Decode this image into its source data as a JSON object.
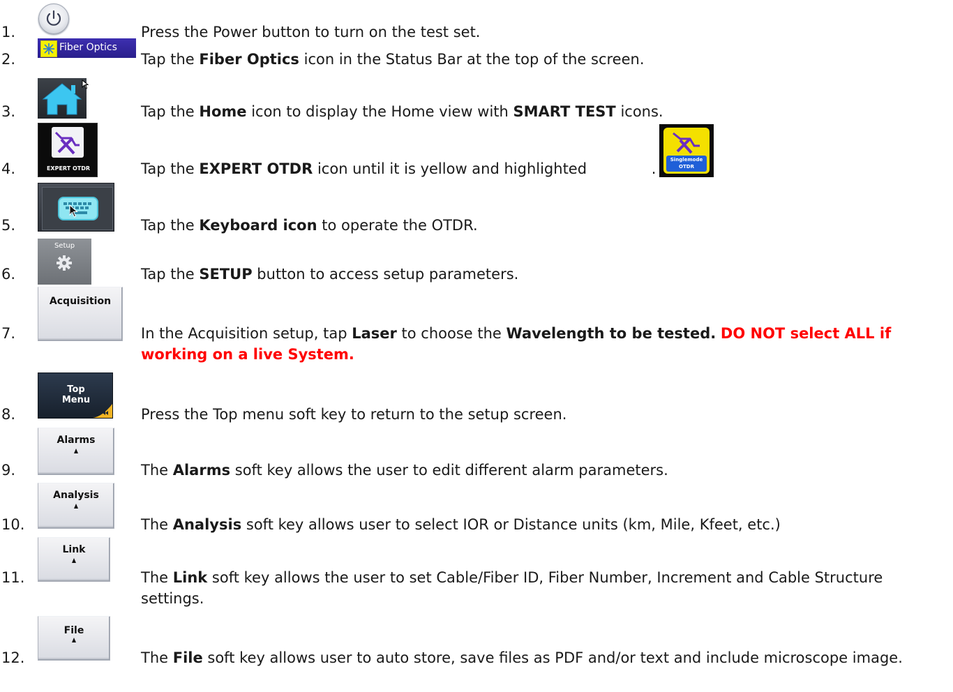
{
  "steps": [
    {
      "n": "1.",
      "icon": "power-button-icon",
      "segments": [
        {
          "t": "Press the Power button to turn on the test set."
        }
      ]
    },
    {
      "n": "2.",
      "icon": "fiber-optics-icon",
      "icon_label": "Fiber Optics",
      "segments": [
        {
          "t": "Tap the "
        },
        {
          "t": "Fiber Optics",
          "b": true
        },
        {
          "t": " icon in the Status Bar at the top of the screen."
        }
      ]
    },
    {
      "n": "3.",
      "icon": "home-icon",
      "segments": [
        {
          "t": "Tap the "
        },
        {
          "t": "Home",
          "b": true
        },
        {
          "t": " icon to display the Home view with "
        },
        {
          "t": "SMART TEST",
          "b": true
        },
        {
          "t": " icons."
        }
      ]
    },
    {
      "n": "4.",
      "icon": "expert-otdr-icon",
      "icon_label": "EXPERT OTDR",
      "segments": [
        {
          "t": "Tap the "
        },
        {
          "t": "EXPERT OTDR",
          "b": true
        },
        {
          "t": " icon until it is yellow and highlighted "
        }
      ],
      "trail": "."
    },
    {
      "n": "5.",
      "icon": "keyboard-icon",
      "segments": [
        {
          "t": "Tap the "
        },
        {
          "t": "Keyboard icon",
          "b": true
        },
        {
          "t": " to operate the OTDR."
        }
      ]
    },
    {
      "n": "6.",
      "icon": "setup-gear-icon",
      "icon_label": "Setup",
      "segments": [
        {
          "t": "Tap the "
        },
        {
          "t": "SETUP",
          "b": true
        },
        {
          "t": " button to access setup parameters."
        }
      ]
    },
    {
      "n": "7.",
      "icon": "acquisition-softkey",
      "icon_label": "Acquisition",
      "segments": [
        {
          "t": "In the Acquisition setup, tap "
        },
        {
          "t": "Laser",
          "b": true
        },
        {
          "t": " to choose the "
        },
        {
          "t": "Wavelength to be tested.",
          "b": true
        },
        {
          "t": "  "
        },
        {
          "t": "DO NOT select ALL if working on a live System.",
          "r": true
        }
      ]
    },
    {
      "n": "8.",
      "icon": "top-menu-softkey",
      "icon_label": "Top\nMenu",
      "segments": [
        {
          "t": "Press the Top menu soft key to return to the setup screen."
        }
      ]
    },
    {
      "n": "9.",
      "icon": "alarms-softkey",
      "icon_label": "Alarms",
      "segments": [
        {
          "t": "The "
        },
        {
          "t": "Alarms",
          "b": true
        },
        {
          "t": " soft key allows the user to edit different alarm parameters."
        }
      ]
    },
    {
      "n": "10.",
      "icon": "analysis-softkey",
      "icon_label": "Analysis",
      "segments": [
        {
          "t": "The "
        },
        {
          "t": "Analysis",
          "b": true
        },
        {
          "t": " soft key allows user to select IOR or Distance units (km, Mile, Kfeet, etc.)"
        }
      ]
    },
    {
      "n": "11.",
      "icon": "link-softkey",
      "icon_label": "Link",
      "segments": [
        {
          "t": "The "
        },
        {
          "t": "Link",
          "b": true
        },
        {
          "t": " soft key allows the user to set Cable/Fiber ID, Fiber Number, Increment and Cable Structure settings."
        }
      ]
    },
    {
      "n": "12.",
      "icon": "file-softkey",
      "icon_label": "File",
      "segments": [
        {
          "t": "The "
        },
        {
          "t": "File",
          "b": true
        },
        {
          "t": " soft key allows user to auto store, save files as PDF and/or text and include microscope image."
        }
      ]
    }
  ],
  "inline_icon": {
    "name": "singlemode-otdr-icon",
    "label_line1": "Singlemode",
    "label_line2": "OTDR"
  },
  "colors": {
    "warning_red": "#ff0000",
    "highlight_yellow": "#f4e000",
    "purple_accent": "#6a2fc0"
  }
}
